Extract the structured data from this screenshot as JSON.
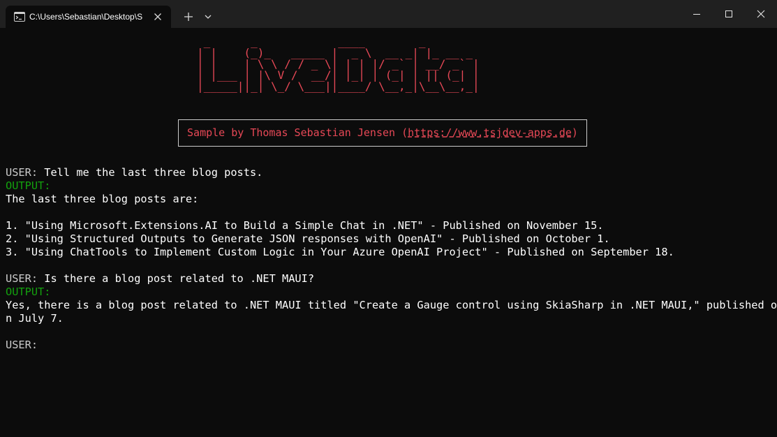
{
  "window": {
    "tab_title": "C:\\Users\\Sebastian\\Desktop\\S",
    "icons": {
      "tab": "terminal-icon",
      "close": "close-icon",
      "new_tab": "plus-icon",
      "dropdown": "chevron-down-icon",
      "minimize": "minimize-icon",
      "maximize": "maximize-icon",
      "window_close": "close-icon"
    }
  },
  "terminal": {
    "banner_ascii": " _      _            ____        _\n| |    (_)_   _____ |  _ \\  __ _| |_ __ _\n| |    | \\ \\ / / _ \\| | | |/ _` | __/ _` |\n| |___ | |\\ V /  __/| |_| | (_| | || (_| |\n|_____||_| \\_/ \\___||____/ \\__,_|\\__\\__,_|",
    "banner_color": "#e74856",
    "sample_prefix": "Sample by Thomas Sebastian Jensen (",
    "sample_link": "https://www.tsjdev-apps.de",
    "sample_suffix": ")",
    "conversation": [
      {
        "label": "USER: ",
        "text": "Tell me the last three blog posts."
      },
      {
        "label": "OUTPUT:"
      },
      {
        "text": "The last three blog posts are:"
      },
      {
        "text": "1. \"Using Microsoft.Extensions.AI to Build a Simple Chat in .NET\" - Published on November 15."
      },
      {
        "text": "2. \"Using Structured Outputs to Generate JSON responses with OpenAI\" - Published on October 1."
      },
      {
        "text": "3. \"Using ChatTools to Implement Custom Logic in Your Azure OpenAI Project\" - Published on September 18."
      },
      {
        "label": "USER: ",
        "text": "Is there a blog post related to .NET MAUI?"
      },
      {
        "label": "OUTPUT:"
      },
      {
        "text": "Yes, there is a blog post related to .NET MAUI titled \"Create a Gauge control using SkiaSharp in .NET MAUI,\" published o"
      },
      {
        "text": "n July 7."
      },
      {
        "label": "USER:"
      }
    ],
    "colors": {
      "user_label": "#cccccc",
      "output_label": "#13a10e",
      "text": "#ffffff",
      "background": "#0c0c0c"
    }
  }
}
